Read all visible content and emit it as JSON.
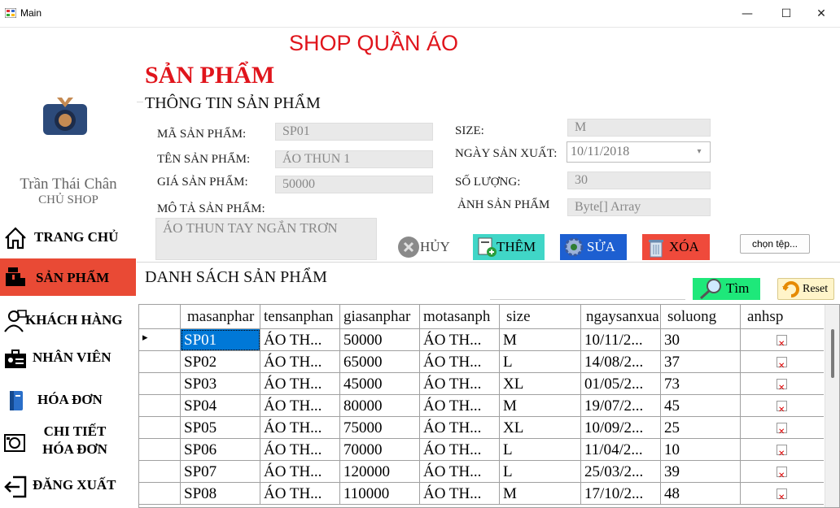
{
  "window": {
    "title": "Main",
    "minimize": "—",
    "maximize": "☐",
    "close": "✕"
  },
  "sidebar": {
    "owner_name": "Trần Thái Chân",
    "owner_role": "CHỦ SHOP",
    "items": [
      {
        "label": "TRANG CHỦ",
        "icon": "home-icon"
      },
      {
        "label": "SẢN PHẨM",
        "icon": "product-box-icon",
        "active": true
      },
      {
        "label": "KHÁCH HÀNG",
        "icon": "customer-icon"
      },
      {
        "label": "NHÂN VIÊN",
        "icon": "employee-card-icon"
      },
      {
        "label": "HÓA ĐƠN",
        "icon": "invoice-icon"
      },
      {
        "label": "CHI TIẾT\nHÓA ĐƠN",
        "icon": "invoice-detail-icon"
      },
      {
        "label": "ĐĂNG XUẤT",
        "icon": "logout-icon"
      }
    ]
  },
  "header": {
    "shop_title": "SHOP QUẦN ÁO",
    "page_title": "SẢN PHẨM"
  },
  "info": {
    "group_title": "THÔNG TIN SẢN PHẨM",
    "labels": {
      "ma": "MÃ SẢN PHẨM:",
      "ten": "TÊN SẢN PHẨM:",
      "gia": "GIÁ SẢN PHẨM:",
      "mota": "MÔ TẢ SẢN PHẨM:",
      "size": "SIZE:",
      "ngay": "NGÀY SẢN XUẤT:",
      "soluong": "SỐ LƯỢNG:",
      "anh": "ẢNH SẢN PHẨM"
    },
    "values": {
      "ma": "SP01",
      "ten": "ÁO THUN 1",
      "gia": "50000",
      "mota": "ÁO THUN TAY NGẮN TRƠN",
      "size": "M",
      "ngay": "10/11/2018",
      "soluong": "30",
      "anh": "Byte[] Array"
    },
    "buttons": {
      "huy": "HỦY",
      "them": "THÊM",
      "sua": "SỬA",
      "xoa": "XÓA",
      "chon_tep": "chọn tệp..."
    }
  },
  "list": {
    "group_title": "DANH SÁCH SẢN PHẨM",
    "search_button": "Tìm",
    "reset_button": "Reset",
    "search_value": "",
    "columns": [
      "masanphar",
      "tensanphan",
      "giasanphar",
      "motasanph",
      "size",
      "ngaysanxua",
      "soluong",
      "anhsp"
    ],
    "rows": [
      [
        "SP01",
        "ÁO TH...",
        "50000",
        "ÁO TH...",
        "M",
        "10/11/2...",
        "30"
      ],
      [
        "SP02",
        "ÁO TH...",
        "65000",
        "ÁO TH...",
        "L",
        "14/08/2...",
        "37"
      ],
      [
        "SP03",
        "ÁO TH...",
        "45000",
        "ÁO TH...",
        "XL",
        "01/05/2...",
        "73"
      ],
      [
        "SP04",
        "ÁO TH...",
        "80000",
        "ÁO TH...",
        "M",
        "19/07/2...",
        "45"
      ],
      [
        "SP05",
        "ÁO TH...",
        "75000",
        "ÁO TH...",
        "XL",
        "10/09/2...",
        "25"
      ],
      [
        "SP06",
        "ÁO TH...",
        "70000",
        "ÁO TH...",
        "L",
        "11/04/2...",
        "10"
      ],
      [
        "SP07",
        "ÁO TH...",
        "120000",
        "ÁO TH...",
        "L",
        "25/03/2...",
        "39"
      ],
      [
        "SP08",
        "ÁO TH...",
        "110000",
        "ÁO TH...",
        "M",
        "17/10/2...",
        "48"
      ]
    ],
    "selected_row": 0
  },
  "colors": {
    "accent_red": "#e0151c",
    "active_nav": "#e94a35",
    "selection": "#0078d7"
  }
}
